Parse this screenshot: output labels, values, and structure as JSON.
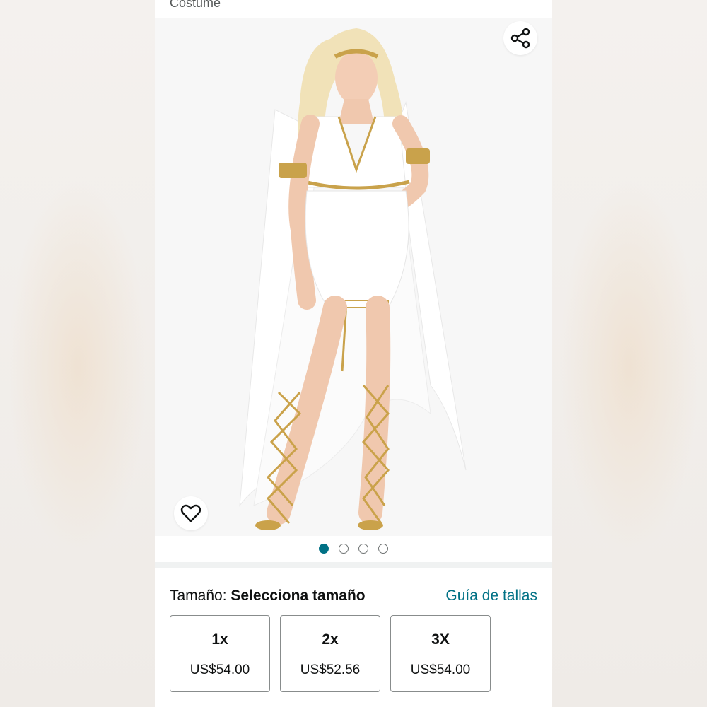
{
  "product": {
    "title_fragment": "Costume"
  },
  "gallery": {
    "image_description_icon": "goddess-costume-photo",
    "share_icon": "share-icon",
    "wishlist_icon": "heart-icon",
    "page_count": 4,
    "active_page": 1
  },
  "size_selector": {
    "label": "Tamaño:",
    "value": "Selecciona tamaño",
    "guide_link": "Guía de tallas",
    "options": [
      {
        "name": "1x",
        "price": "US$54.00"
      },
      {
        "name": "2x",
        "price": "US$52.56"
      },
      {
        "name": "3X",
        "price": "US$54.00"
      }
    ]
  },
  "colors": {
    "accent": "#007185",
    "text": "#0f1111",
    "border": "#888c8c"
  }
}
